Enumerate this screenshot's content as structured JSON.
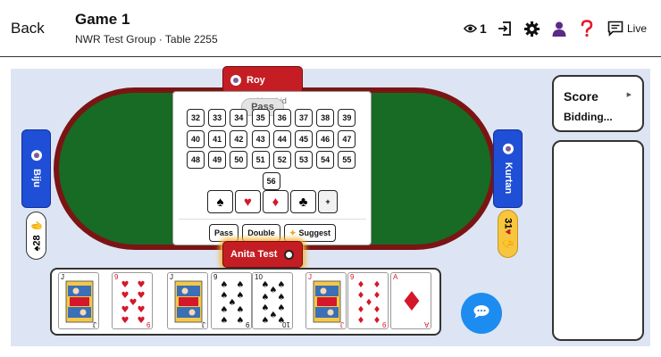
{
  "header": {
    "back_label": "Back",
    "title": "Game 1",
    "subtitle": "NWR Test Group · Table 2255",
    "viewers_count": "1",
    "live_label": "Live",
    "icons": [
      "eye-icon",
      "exit-icon",
      "gear-icon",
      "user-icon",
      "help-icon",
      "chat-icon"
    ]
  },
  "players": {
    "north": {
      "name": "Roy"
    },
    "south": {
      "name": "Anita Test"
    },
    "west": {
      "name": "Biju",
      "bid": "28"
    },
    "east": {
      "name": "Kurtan",
      "bid": "31"
    }
  },
  "bidding": {
    "ghost_title": "Your bid",
    "last_bid_bubble": "Pass",
    "numbers": [
      "32",
      "33",
      "34",
      "35",
      "36",
      "37",
      "38",
      "39",
      "40",
      "41",
      "42",
      "43",
      "44",
      "45",
      "46",
      "47",
      "48",
      "49",
      "50",
      "51",
      "52",
      "53",
      "54",
      "55",
      "56"
    ],
    "suits": [
      "♠",
      "♥",
      "♦",
      "♣"
    ],
    "plus_label": "+",
    "actions": {
      "pass": "Pass",
      "double": "Double",
      "suggest": "Suggest"
    }
  },
  "hand": [
    {
      "rank": "J",
      "suit": "♠",
      "color": "black"
    },
    {
      "rank": "9",
      "suit": "♥",
      "color": "red"
    },
    {
      "rank": "J",
      "suit": "♣",
      "color": "black"
    },
    {
      "rank": "9",
      "suit": "♠",
      "color": "black"
    },
    {
      "rank": "10",
      "suit": "♠",
      "color": "black"
    },
    {
      "rank": "J",
      "suit": "♦",
      "color": "red"
    },
    {
      "rank": "9",
      "suit": "♦",
      "color": "red"
    },
    {
      "rank": "A",
      "suit": "♦",
      "color": "red"
    }
  ],
  "score": {
    "title": "Score",
    "status": "Bidding..."
  },
  "colors": {
    "table_felt": "#176b24",
    "table_rim": "#7c1414",
    "seat_red": "#c41e24",
    "seat_blue": "#1f4fd6",
    "bid_yellow": "#f7c63e",
    "chat_blue": "#1d8cf0",
    "background": "#dde5f4"
  }
}
